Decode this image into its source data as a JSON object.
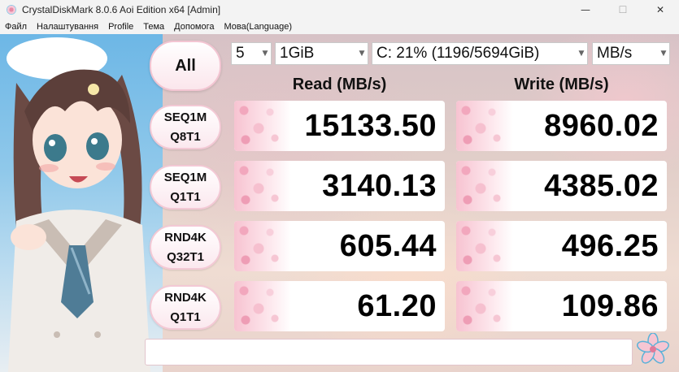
{
  "window": {
    "title": "CrystalDiskMark 8.0.6 Aoi Edition x64 [Admin]",
    "controls": {
      "minimize": "—",
      "maximize": "☐",
      "close": "✕"
    }
  },
  "menu": [
    "Файл",
    "Налаштування",
    "Profile",
    "Тема",
    "Допомога",
    "Мова(Language)"
  ],
  "toolbar": {
    "all_label": "All",
    "count": "5",
    "size": "1GiB",
    "drive": "C: 21% (1196/5694GiB)",
    "unit": "MB/s"
  },
  "headers": {
    "read": "Read (MB/s)",
    "write": "Write (MB/s)"
  },
  "tests": [
    {
      "line1": "SEQ1M",
      "line2": "Q8T1",
      "read": "15133.50",
      "write": "8960.02"
    },
    {
      "line1": "SEQ1M",
      "line2": "Q1T1",
      "read": "3140.13",
      "write": "4385.02"
    },
    {
      "line1": "RND4K",
      "line2": "Q32T1",
      "read": "605.44",
      "write": "496.25"
    },
    {
      "line1": "RND4K",
      "line2": "Q1T1",
      "read": "61.20",
      "write": "109.86"
    }
  ],
  "comment": "",
  "colors": {
    "accent_pink": "#f3c5d2",
    "sky_blue": "#6db7e6"
  }
}
